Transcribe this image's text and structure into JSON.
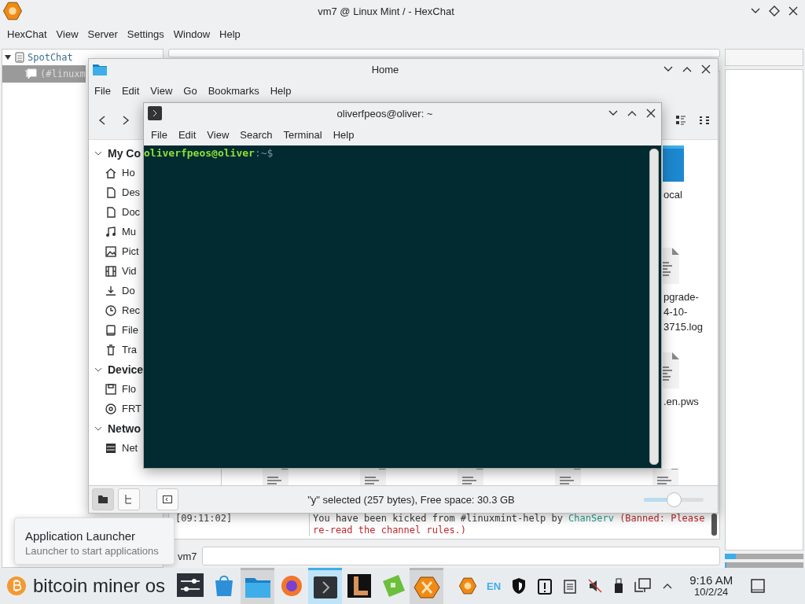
{
  "hexchat": {
    "title": "vm7 @ Linux Mint / - HexChat",
    "menu": [
      "HexChat",
      "View",
      "Server",
      "Settings",
      "Window",
      "Help"
    ],
    "tree": [
      {
        "label": "SpotChat",
        "expanded": true,
        "children": [
          {
            "label": "(#linuxm",
            "selected": true
          }
        ]
      }
    ],
    "chat": [
      {
        "time": "[09:11:02]",
        "parts": [
          {
            "text": "You have been kicked from #linuxmint-help by ",
            "color": "#3a3a3a"
          },
          {
            "text": "ChanServ",
            "color": "#2a9d8f"
          },
          {
            "text": " (Banned: Please re-read the channel rules.)",
            "color": "#c0282e"
          }
        ]
      }
    ],
    "nick": "vm7",
    "meters": [
      {
        "level": 0.14
      },
      {
        "level": 0.02
      }
    ]
  },
  "file_manager": {
    "title": "Home",
    "menu": [
      "File",
      "Edit",
      "View",
      "Go",
      "Bookmarks",
      "Help"
    ],
    "places": [
      {
        "heading": "My Co",
        "expanded": true,
        "items": [
          {
            "label": "Ho"
          },
          {
            "label": "Des"
          },
          {
            "label": "Doc"
          },
          {
            "label": "Mu"
          },
          {
            "label": "Pict"
          },
          {
            "label": "Vid"
          },
          {
            "label": "Do"
          },
          {
            "label": "Rec"
          },
          {
            "label": "File"
          },
          {
            "label": "Tra"
          }
        ]
      },
      {
        "heading": "Device",
        "expanded": true,
        "items": [
          {
            "label": "Flo"
          },
          {
            "label": "FRT"
          }
        ]
      },
      {
        "heading": "Netwo",
        "expanded": true,
        "items": [
          {
            "label": "Net"
          }
        ]
      }
    ],
    "files": [
      {
        "kind": "folder",
        "lines": [
          "ocal"
        ]
      },
      {
        "kind": "document",
        "lines": [
          "pgrade-",
          "4-10-",
          "3715.log"
        ]
      },
      {
        "kind": "document",
        "lines": [
          ".en.pws"
        ]
      }
    ],
    "bottom_files": [
      {
        "kind": "document"
      },
      {
        "kind": "document"
      },
      {
        "kind": "document"
      },
      {
        "kind": "document"
      },
      {
        "kind": "document"
      }
    ],
    "status": "\"y\" selected (257 bytes), Free space: 30.3 GB",
    "zoom": {
      "level": 0.5
    }
  },
  "terminal": {
    "title": "oliverfpeos@oliver: ~",
    "menu": [
      "File",
      "Edit",
      "View",
      "Search",
      "Terminal",
      "Help"
    ],
    "prompt_user": "oliverfpeos@oliver",
    "prompt_path": ":~$"
  },
  "tooltip": {
    "title": "Application Launcher",
    "subtitle": "Launcher to start applications"
  },
  "taskbar": {
    "launcher": "bitcoin miner os",
    "tasks": [
      {
        "running": false,
        "focused": false
      },
      {
        "running": false,
        "focused": false
      },
      {
        "running": true,
        "focused": false
      },
      {
        "running": false,
        "focused": false
      },
      {
        "running": true,
        "focused": true
      },
      {
        "running": false,
        "focused": false
      },
      {
        "running": false,
        "focused": false
      },
      {
        "running": true,
        "focused": false
      }
    ],
    "keyboard_layout": "EN",
    "time": "9:16 AM",
    "date": "10/2/24"
  }
}
